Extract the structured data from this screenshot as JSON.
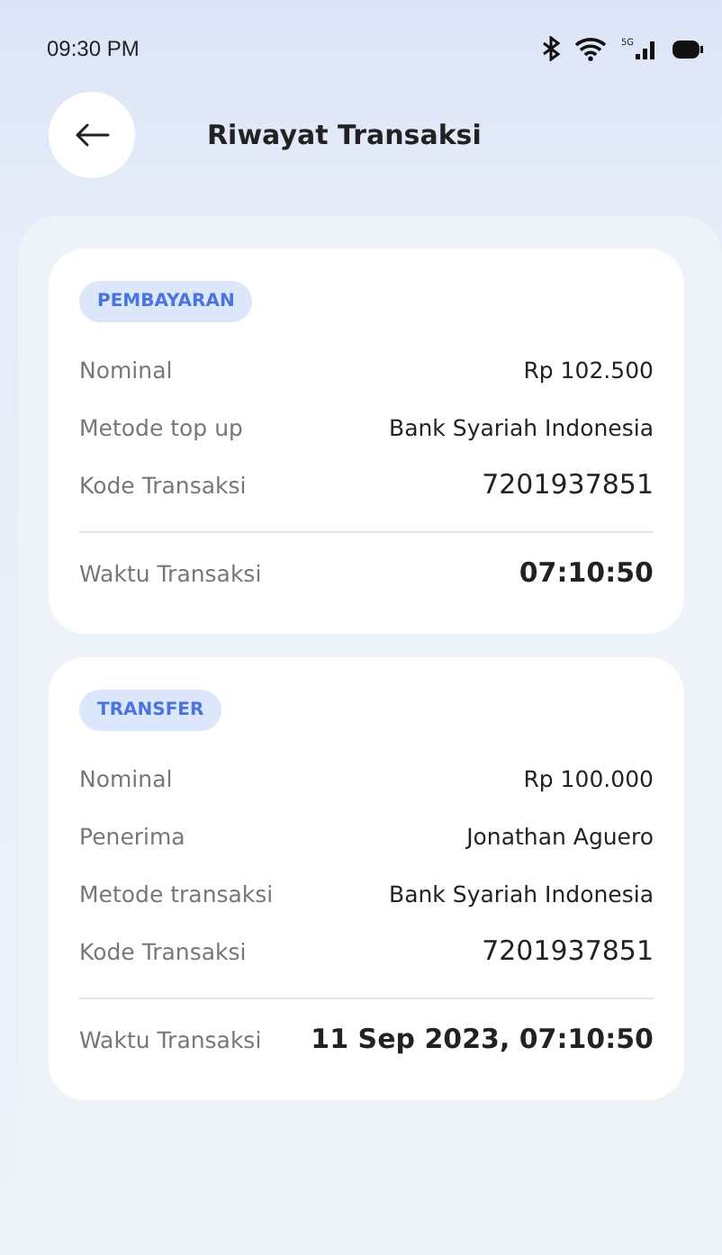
{
  "status_bar": {
    "time": "09:30 PM",
    "network": "5G"
  },
  "header": {
    "title": "Riwayat Transaksi"
  },
  "transactions": [
    {
      "badge": "PEMBAYARAN",
      "rows": [
        {
          "label": "Nominal",
          "value": "Rp 102.500"
        },
        {
          "label": "Metode top up",
          "value": "Bank Syariah Indonesia"
        },
        {
          "label": "Kode Transaksi",
          "value": "7201937851",
          "kind": "code"
        }
      ],
      "time_label": "Waktu Transaksi",
      "time_value": "07:10:50"
    },
    {
      "badge": "TRANSFER",
      "rows": [
        {
          "label": "Nominal",
          "value": "Rp 100.000"
        },
        {
          "label": "Penerima",
          "value": "Jonathan Aguero"
        },
        {
          "label": "Metode transaksi",
          "value": "Bank Syariah Indonesia"
        },
        {
          "label": "Kode Transaksi",
          "value": "7201937851",
          "kind": "code"
        }
      ],
      "time_label": "Waktu Transaksi",
      "time_value": "11 Sep 2023, 07:10:50"
    }
  ]
}
